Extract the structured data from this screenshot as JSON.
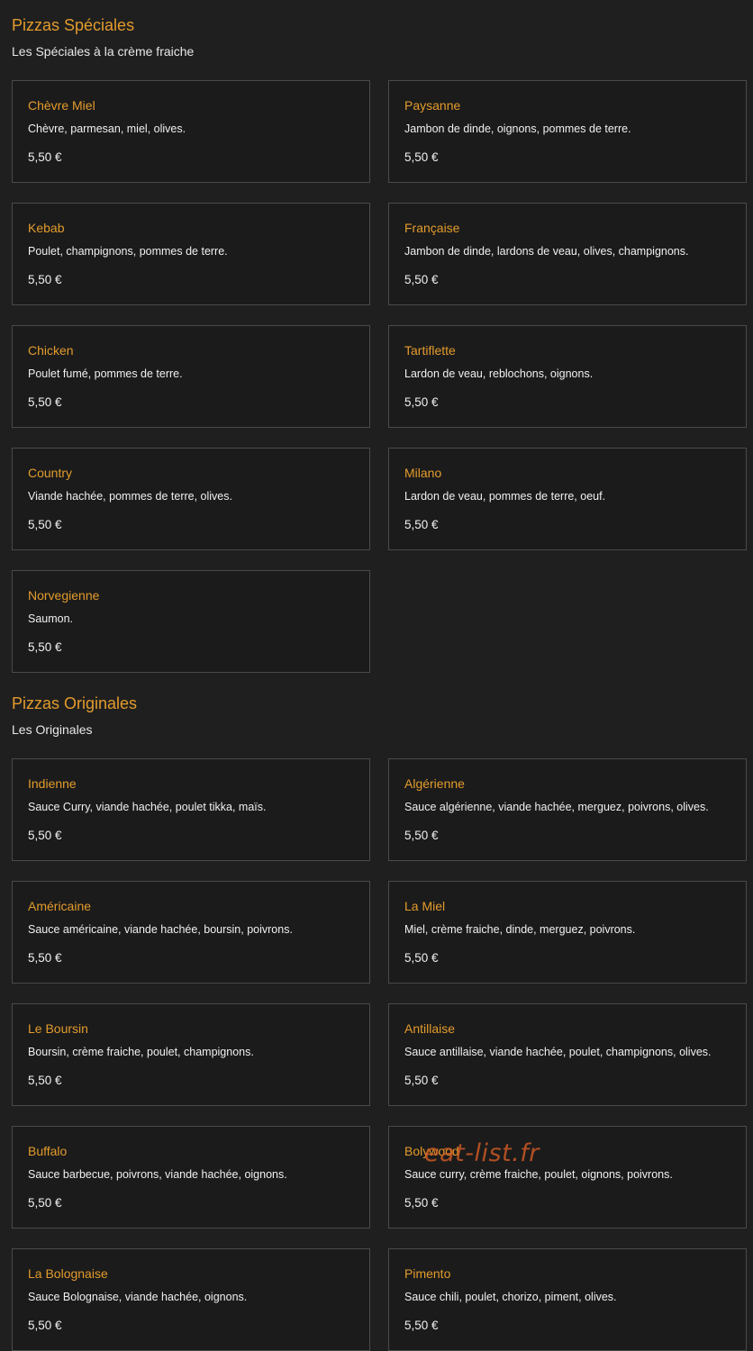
{
  "sections": [
    {
      "title": "Pizzas Spéciales",
      "subtitle": "Les Spéciales à la crème fraiche",
      "items": [
        {
          "name": "Chèvre Miel",
          "desc": "Chèvre, parmesan, miel, olives.",
          "price": "5,50 €"
        },
        {
          "name": "Paysanne",
          "desc": "Jambon de dinde, oignons, pommes de terre.",
          "price": "5,50 €"
        },
        {
          "name": "Kebab",
          "desc": "Poulet, champignons, pommes de terre.",
          "price": "5,50 €"
        },
        {
          "name": "Française",
          "desc": "Jambon de dinde, lardons de veau, olives, champignons.",
          "price": "5,50 €"
        },
        {
          "name": "Chicken",
          "desc": "Poulet fumé, pommes de terre.",
          "price": "5,50 €"
        },
        {
          "name": "Tartiflette",
          "desc": "Lardon de veau, reblochons, oignons.",
          "price": "5,50 €"
        },
        {
          "name": "Country",
          "desc": "Viande hachée, pommes de terre, olives.",
          "price": "5,50 €"
        },
        {
          "name": "Milano",
          "desc": "Lardon de veau, pommes de terre, oeuf.",
          "price": "5,50 €"
        },
        {
          "name": "Norvegienne",
          "desc": "Saumon.",
          "price": "5,50 €"
        }
      ]
    },
    {
      "title": "Pizzas Originales",
      "subtitle": "Les Originales",
      "items": [
        {
          "name": "Indienne",
          "desc": "Sauce Curry, viande hachée, poulet tikka, maïs.",
          "price": "5,50 €"
        },
        {
          "name": "Algérienne",
          "desc": "Sauce algérienne, viande hachée, merguez, poivrons, olives.",
          "price": "5,50 €"
        },
        {
          "name": "Américaine",
          "desc": "Sauce américaine, viande hachée, boursin, poivrons.",
          "price": "5,50 €"
        },
        {
          "name": "La Miel",
          "desc": "Miel, crème fraiche, dinde, merguez, poivrons.",
          "price": "5,50 €"
        },
        {
          "name": "Le Boursin",
          "desc": "Boursin, crème fraiche, poulet, champignons.",
          "price": "5,50 €"
        },
        {
          "name": "Antillaise",
          "desc": "Sauce antillaise, viande hachée, poulet, champignons, olives.",
          "price": "5,50 €"
        },
        {
          "name": "Buffalo",
          "desc": "Sauce barbecue, poivrons, viande hachée, oignons.",
          "price": "5,50 €"
        },
        {
          "name": "Bolywood",
          "desc": "Sauce curry, crème fraiche, poulet, oignons, poivrons.",
          "price": "5,50 €"
        },
        {
          "name": "La Bolognaise",
          "desc": "Sauce Bolognaise, viande hachée, oignons.",
          "price": "5,50 €"
        },
        {
          "name": "Pimento",
          "desc": "Sauce chili, poulet, chorizo, piment, olives.",
          "price": "5,50 €"
        }
      ]
    }
  ],
  "watermark": "eat-list.fr",
  "colors": {
    "background": "#1f1f1f",
    "accent": "#e39b2c",
    "card_border": "#4a4a4a",
    "watermark": "#d65c26"
  }
}
